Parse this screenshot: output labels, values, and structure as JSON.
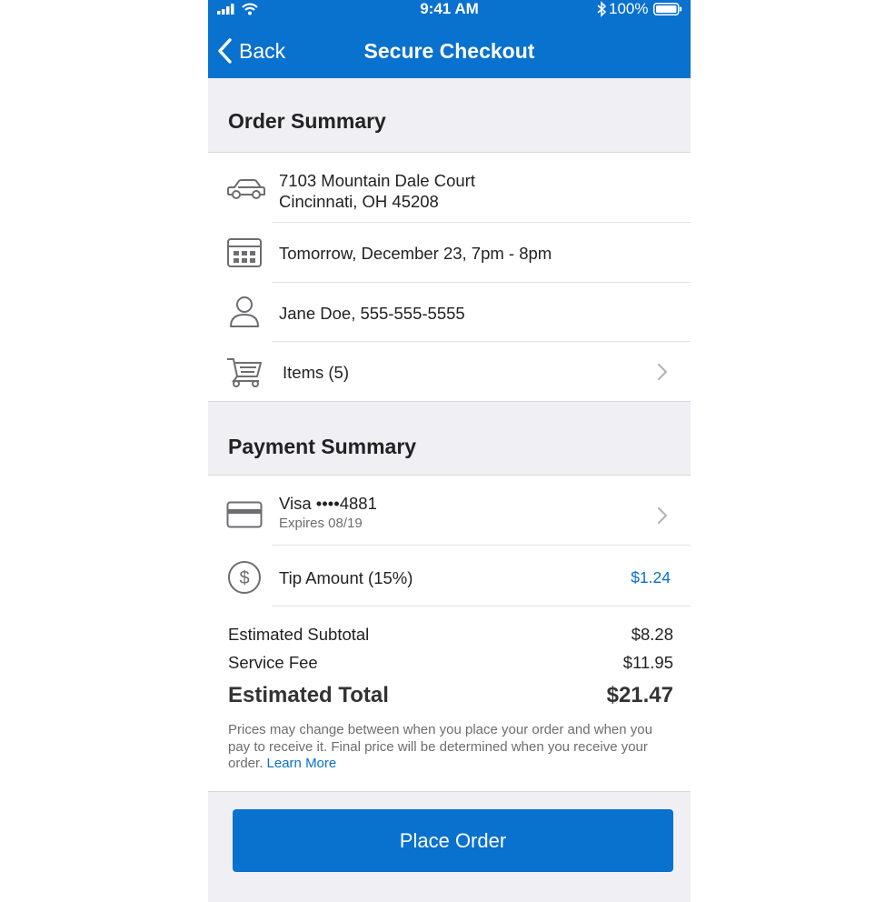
{
  "status_bar": {
    "time": "9:41 AM",
    "battery": "100%"
  },
  "nav": {
    "back_label": "Back",
    "title": "Secure Checkout"
  },
  "order_summary": {
    "heading": "Order Summary",
    "address_line1": "7103 Mountain Dale Court",
    "address_line2": "Cincinnati, OH 45208",
    "delivery_time": "Tomorrow, December 23, 7pm - 8pm",
    "contact": "Jane Doe, 555-555-5555",
    "items": "Items (5)"
  },
  "payment_summary": {
    "heading": "Payment Summary",
    "card": "Visa ••••4881",
    "card_expiry": "Expires 08/19",
    "tip_label": "Tip Amount (15%)",
    "tip_value": "$1.24"
  },
  "totals": {
    "subtotal_label": "Estimated Subtotal",
    "subtotal_value": "$8.28",
    "fee_label": "Service Fee",
    "fee_value": "$11.95",
    "total_label": "Estimated Total",
    "total_value": "$21.47"
  },
  "disclaimer": {
    "text": "Prices may change between when you place your order and when you pay to receive it. Final price will be determined when you receive your order. ",
    "link": "Learn More"
  },
  "footer": {
    "place_order_label": "Place Order"
  },
  "colors": {
    "accent": "#0971ce",
    "background": "#efeff4",
    "icon": "#6d6d72"
  },
  "icons": [
    "signal-icon",
    "wifi-icon",
    "bluetooth-icon",
    "battery-icon",
    "back-chevron-icon",
    "car-icon",
    "calendar-icon",
    "person-icon",
    "cart-icon",
    "credit-card-icon",
    "dollar-icon",
    "chevron-right-icon"
  ]
}
